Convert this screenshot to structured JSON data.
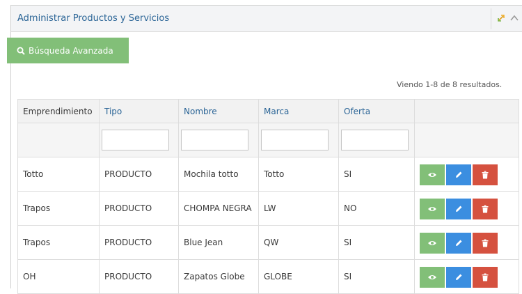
{
  "panel": {
    "title": "Administrar Productos y Servicios",
    "expand_icon": "expand-icon",
    "collapse_icon": "chevron-up-icon"
  },
  "search_button": {
    "label": "Búsqueda Avanzada",
    "icon": "search-icon",
    "color": "#82bf78"
  },
  "summary": "Viendo 1-8 de 8 resultados.",
  "table": {
    "columns": [
      {
        "label": "Emprendimiento",
        "sortable": false
      },
      {
        "label": "Tipo",
        "sortable": true
      },
      {
        "label": "Nombre",
        "sortable": true
      },
      {
        "label": "Marca",
        "sortable": true
      },
      {
        "label": "Oferta",
        "sortable": true
      }
    ],
    "filters": {
      "tipo": "",
      "nombre": "",
      "marca": "",
      "oferta": ""
    },
    "rows": [
      {
        "emprendimiento": "Totto",
        "tipo": "PRODUCTO",
        "nombre": "Mochila totto",
        "marca": "Totto",
        "oferta": "SI"
      },
      {
        "emprendimiento": "Trapos",
        "tipo": "PRODUCTO",
        "nombre": "CHOMPA NEGRA",
        "marca": "LW",
        "oferta": "NO"
      },
      {
        "emprendimiento": "Trapos",
        "tipo": "PRODUCTO",
        "nombre": "Blue Jean",
        "marca": "QW",
        "oferta": "SI"
      },
      {
        "emprendimiento": "OH",
        "tipo": "PRODUCTO",
        "nombre": "Zapatos Globe",
        "marca": "GLOBE",
        "oferta": "SI"
      }
    ],
    "actions": [
      {
        "icon": "eye-icon",
        "color": "#82bf78"
      },
      {
        "icon": "pencil-icon",
        "color": "#3b8ee0"
      },
      {
        "icon": "trash-icon",
        "color": "#d5513f"
      }
    ]
  }
}
